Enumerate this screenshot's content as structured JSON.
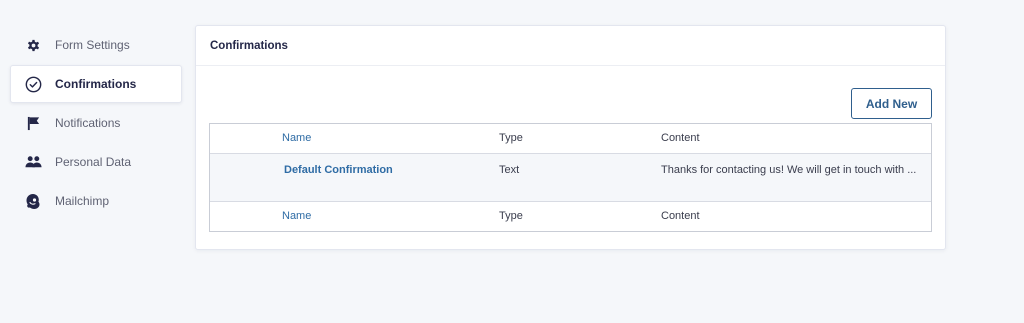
{
  "sidebar": {
    "items": [
      {
        "label": "Form Settings",
        "icon": "gear-icon",
        "active": false
      },
      {
        "label": "Confirmations",
        "icon": "check-circle-icon",
        "active": true
      },
      {
        "label": "Notifications",
        "icon": "flag-icon",
        "active": false
      },
      {
        "label": "Personal Data",
        "icon": "users-icon",
        "active": false
      },
      {
        "label": "Mailchimp",
        "icon": "mailchimp-icon",
        "active": false
      }
    ]
  },
  "panel": {
    "title": "Confirmations",
    "add_new_label": "Add New",
    "table": {
      "headers": {
        "name": "Name",
        "type": "Type",
        "content": "Content"
      },
      "rows": [
        {
          "name": "Default Confirmation",
          "type": "Text",
          "content": "Thanks for contacting us! We will get in touch with ..."
        }
      ],
      "footers": {
        "name": "Name",
        "type": "Type",
        "content": "Content"
      }
    }
  },
  "colors": {
    "background": "#f5f7fa",
    "accent": "#2f5f8d",
    "link": "#2f6ca5",
    "text": "#242748"
  }
}
